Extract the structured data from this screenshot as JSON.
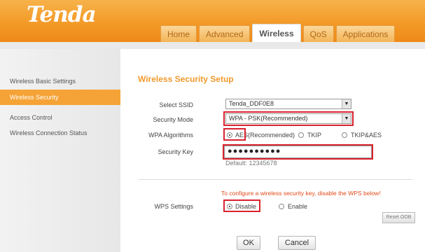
{
  "brand": {
    "logo": "Tenda"
  },
  "tabs": [
    {
      "label": "Home",
      "active": false
    },
    {
      "label": "Advanced",
      "active": false
    },
    {
      "label": "Wireless",
      "active": true
    },
    {
      "label": "QoS",
      "active": false
    },
    {
      "label": "Applications",
      "active": false
    }
  ],
  "sidebar": {
    "items": [
      {
        "label": "Wireless Basic Settings",
        "active": false
      },
      {
        "label": "Wireless Security",
        "active": true
      },
      {
        "label": "Access Control",
        "active": false
      },
      {
        "label": "Wireless Connection Status",
        "active": false
      }
    ]
  },
  "form": {
    "title": "Wireless Security Setup",
    "ssid": {
      "label": "Select SSID",
      "value": "Tenda_DDF0E8"
    },
    "security_mode": {
      "label": "Security Mode",
      "value": "WPA - PSK(Recommended)"
    },
    "wpa_algorithms": {
      "label": "WPA Algorithms",
      "options": [
        {
          "label": "AES(Recommended)",
          "checked": true
        },
        {
          "label": "TKIP",
          "checked": false
        },
        {
          "label": "TKIP&AES",
          "checked": false
        }
      ]
    },
    "security_key": {
      "label": "Security Key",
      "value": "●●●●●●●●●●",
      "hint": "Default: 12345678"
    },
    "wps_warning": "To configure a wireless security key, disable the WPS below!",
    "wps": {
      "label": "WPS Settings",
      "options": [
        {
          "label": "Disable",
          "checked": true
        },
        {
          "label": "Enable",
          "checked": false
        }
      ]
    },
    "reset_oob_label": "Reset OOB",
    "ok_label": "OK",
    "cancel_label": "Cancel"
  },
  "colors": {
    "brand_orange": "#f39a28",
    "highlight_red": "#d9232e",
    "active_nav": "#f5a336",
    "title_orange": "#f29a2c"
  }
}
